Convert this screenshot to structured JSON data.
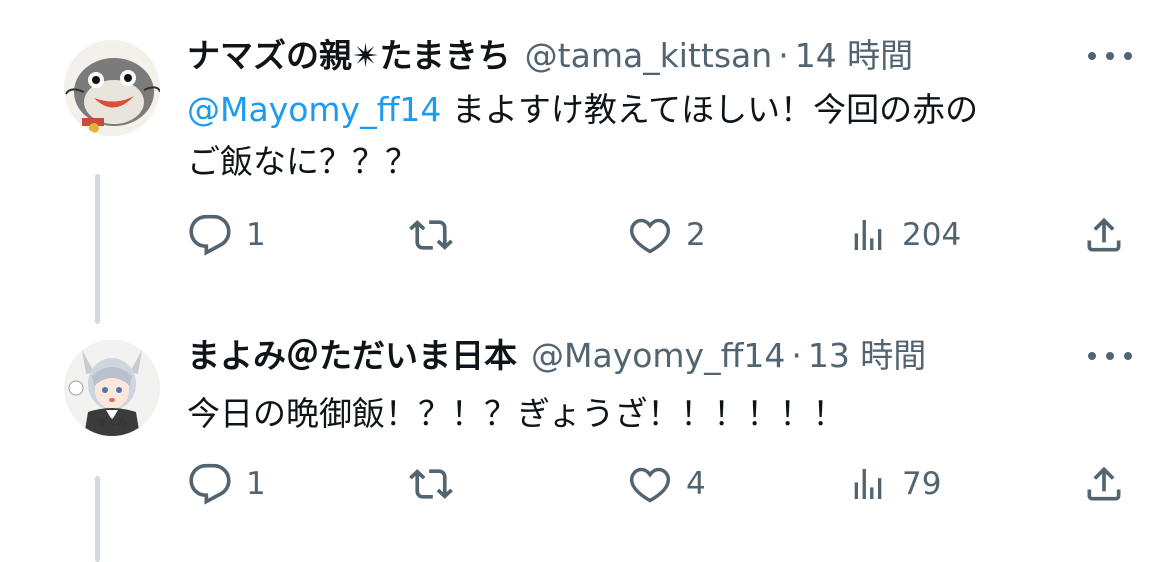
{
  "tweets": [
    {
      "name": "ナマズの親✴︎たまきち",
      "handle": "@tama_kittsan",
      "separator": "·",
      "time": "14 時間",
      "mention": "@Mayomy_ff14",
      "text_line1": " まよすけ教えてほしい！今回の赤の",
      "text_line2": "ご飯なに？？？",
      "replies": "1",
      "retweets": "",
      "likes": "2",
      "views": "204"
    },
    {
      "name": "まよみ＠ただいま日本",
      "handle": "@Mayomy_ff14",
      "separator": "·",
      "time": "13 時間",
      "text_line1": "今日の晩御飯！？！？ぎょうざ！！！！！！",
      "avatar_label": "まよみ",
      "replies": "1",
      "retweets": "",
      "likes": "4",
      "views": "79"
    }
  ],
  "icons": {
    "reply": "reply-icon",
    "retweet": "retweet-icon",
    "like": "like-icon",
    "views": "views-icon",
    "share": "share-icon",
    "more": "more-icon"
  },
  "colors": {
    "text": "#0f1419",
    "secondary": "#536471",
    "mention": "#1d9bf0",
    "thread_line": "#cfd9de"
  }
}
